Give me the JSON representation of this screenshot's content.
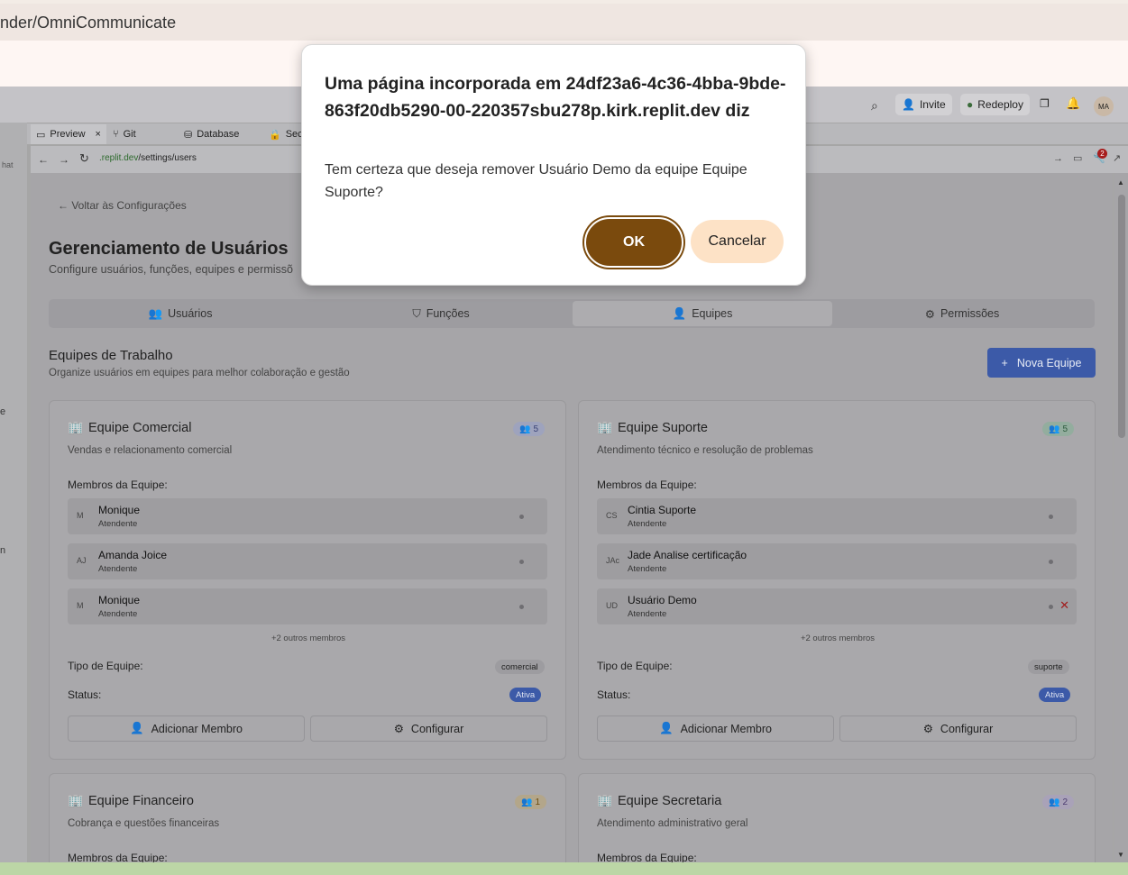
{
  "browser": {
    "url_fragment": "nder/OmniCommunicate"
  },
  "replit": {
    "invite": "Invite",
    "redeploy": "Redeploy",
    "avatar": "MA",
    "tabs": [
      "Preview",
      "Git",
      "Database",
      "Sec"
    ],
    "address": ".replit.dev/settings/users",
    "address_host": ".replit.dev",
    "address_path": "/settings/users",
    "left_fragments": [
      "hat",
      "e",
      "n"
    ],
    "notif_count": "2"
  },
  "app": {
    "back": "Voltar às Configurações",
    "title": "Gerenciamento de Usuários",
    "subtitle": "Configure usuários, funções, equipes e permissõ",
    "tabs": [
      "Usuários",
      "Funções",
      "Equipes",
      "Permissões"
    ],
    "section_title": "Equipes de Trabalho",
    "section_sub": "Organize usuários em equipes para melhor colaboração e gestão",
    "new_team": "Nova Equipe",
    "members_label": "Membros da Equipe:",
    "type_label": "Tipo de Equipe:",
    "status_label": "Status:",
    "add_member": "Adicionar Membro",
    "configure": "Configurar",
    "teams": [
      {
        "name": "Equipe Comercial",
        "desc": "Vendas e relacionamento comercial",
        "count": "5",
        "more": "+2 outros membros",
        "type": "comercial",
        "status": "Ativa",
        "members": [
          {
            "ini": "M",
            "name": "Monique",
            "role": "Atendente"
          },
          {
            "ini": "AJ",
            "name": "Amanda Joice",
            "role": "Atendente"
          },
          {
            "ini": "M",
            "name": "Monique",
            "role": "Atendente"
          }
        ]
      },
      {
        "name": "Equipe Suporte",
        "desc": "Atendimento técnico e resolução de problemas",
        "count": "5",
        "more": "+2 outros membros",
        "type": "suporte",
        "status": "Ativa",
        "members": [
          {
            "ini": "CS",
            "name": "Cintia Suporte",
            "role": "Atendente"
          },
          {
            "ini": "JAc",
            "name": "Jade Analise certificação",
            "role": "Atendente"
          },
          {
            "ini": "UD",
            "name": "Usuário Demo",
            "role": "Atendente"
          }
        ]
      },
      {
        "name": "Equipe Financeiro",
        "desc": "Cobrança e questões financeiras",
        "count": "1"
      },
      {
        "name": "Equipe Secretaria",
        "desc": "Atendimento administrativo geral",
        "count": "2"
      }
    ]
  },
  "dialog": {
    "title": "Uma página incorporada em 24df23a6-4c36-4bba-9bde-863f20db5290-00-220357sbu278p.kirk.replit.dev diz",
    "message": "Tem certeza que deseja remover Usuário Demo da equipe Equipe Suporte?",
    "ok": "OK",
    "cancel": "Cancelar"
  }
}
